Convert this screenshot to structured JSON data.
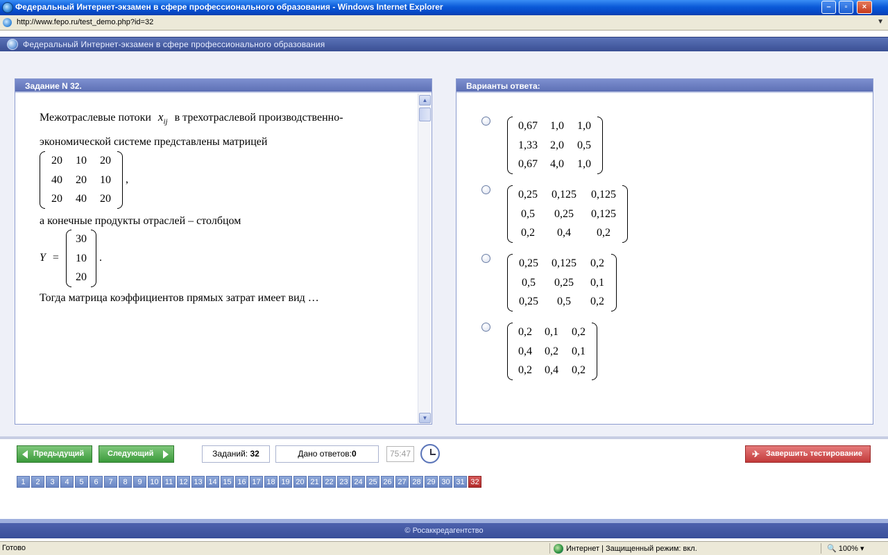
{
  "browser": {
    "title": "Федеральный Интернет-экзамен в сфере профессионального образования - Windows Internet Explorer",
    "url": "http://www.fepo.ru/test_demo.php?id=32",
    "status_left": "Готово",
    "status_zone": "Интернет | Защищенный режим: вкл.",
    "zoom": "100%"
  },
  "site": {
    "header": "Федеральный Интернет-экзамен в сфере профессионального образования",
    "footer": "© Росаккредагентство"
  },
  "question": {
    "heading": "Задание N 32.",
    "line1": "Межотраслевые потоки",
    "var": "x",
    "var_sub": "ij",
    "line1b": "в трехотраслевой производственно-",
    "line2": "экономической системе представлены матрицей",
    "matrix": [
      [
        "20",
        "10",
        "20"
      ],
      [
        "40",
        "20",
        "10"
      ],
      [
        "20",
        "40",
        "20"
      ]
    ],
    "after_matrix": ",",
    "line3": "а конечные продукты отраслей – столбцом",
    "y_label": "Y",
    "equals": "=",
    "column": [
      "30",
      "10",
      "20"
    ],
    "after_column": ".",
    "line4": "Тогда матрица коэффициентов прямых затрат имеет вид …"
  },
  "answers": {
    "heading": "Варианты ответа:",
    "options": [
      [
        [
          "0,67",
          "1,0",
          "1,0"
        ],
        [
          "1,33",
          "2,0",
          "0,5"
        ],
        [
          "0,67",
          "4,0",
          "1,0"
        ]
      ],
      [
        [
          "0,25",
          "0,125",
          "0,125"
        ],
        [
          "0,5",
          "0,25",
          "0,125"
        ],
        [
          "0,2",
          "0,4",
          "0,2"
        ]
      ],
      [
        [
          "0,25",
          "0,125",
          "0,2"
        ],
        [
          "0,5",
          "0,25",
          "0,1"
        ],
        [
          "0,25",
          "0,5",
          "0,2"
        ]
      ],
      [
        [
          "0,2",
          "0,1",
          "0,2"
        ],
        [
          "0,4",
          "0,2",
          "0,1"
        ],
        [
          "0,2",
          "0,4",
          "0,2"
        ]
      ]
    ]
  },
  "nav": {
    "prev": "Предыдущий",
    "next": "Следующий",
    "tasks_label": "Заданий:",
    "tasks_value": "32",
    "answers_label": "Дано ответов:",
    "answers_value": "0",
    "timer": "75:47",
    "finish": "Завершить тестирование",
    "numbers": [
      "1",
      "2",
      "3",
      "4",
      "5",
      "6",
      "7",
      "8",
      "9",
      "10",
      "11",
      "12",
      "13",
      "14",
      "15",
      "16",
      "17",
      "18",
      "19",
      "20",
      "21",
      "22",
      "23",
      "24",
      "25",
      "26",
      "27",
      "28",
      "29",
      "30",
      "31",
      "32"
    ],
    "current": "32"
  }
}
